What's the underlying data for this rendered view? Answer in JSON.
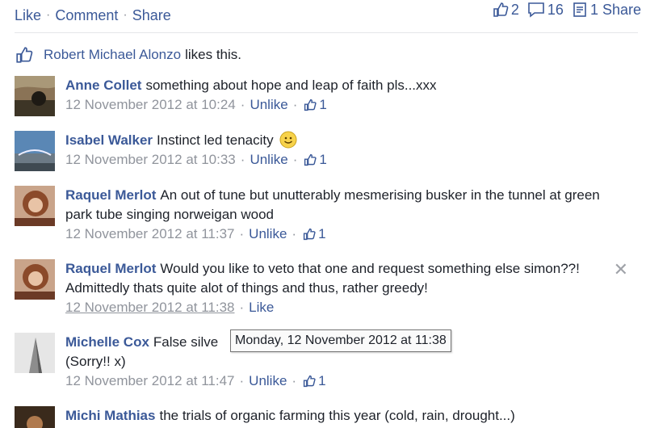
{
  "actions": {
    "like": "Like",
    "comment": "Comment",
    "share": "Share"
  },
  "stats": {
    "likes": "2",
    "comments": "16",
    "shares": "1 Share"
  },
  "likes_line": {
    "name": "Robert Michael Alonzo",
    "suffix": "likes this."
  },
  "comments": [
    {
      "author": "Anne Collet",
      "text": "something about hope and leap of faith pls...xxx",
      "time": "12 November 2012 at 10:24",
      "action": "Unlike",
      "likes": "1"
    },
    {
      "author": "Isabel Walker",
      "text": "Instinct led tenacity",
      "time": "12 November 2012 at 10:33",
      "action": "Unlike",
      "likes": "1"
    },
    {
      "author": "Raquel Merlot",
      "text": "An out of tune but unutterably mesmerising busker in the tunnel at green park tube singing norweigan wood",
      "time": "12 November 2012 at 11:37",
      "action": "Unlike",
      "likes": "1"
    },
    {
      "author": "Raquel Merlot",
      "text": "Would you like to veto that one and request something else simon??! Admittedly thats quite alot of things and thus, rather greedy!",
      "time": "12 November 2012 at 11:38",
      "action": "Like"
    },
    {
      "author": "Michelle Cox",
      "text": "False silve",
      "text2": "(Sorry!! x)",
      "time": "12 November 2012 at 11:47",
      "action": "Unlike",
      "likes": "1"
    },
    {
      "author": "Michi Mathias",
      "text": "the trials of organic farming this year (cold, rain, drought...)"
    }
  ],
  "tooltip": "Monday, 12 November 2012 at 11:38",
  "colors": {
    "link": "#3b5998",
    "meta": "#90949c"
  }
}
